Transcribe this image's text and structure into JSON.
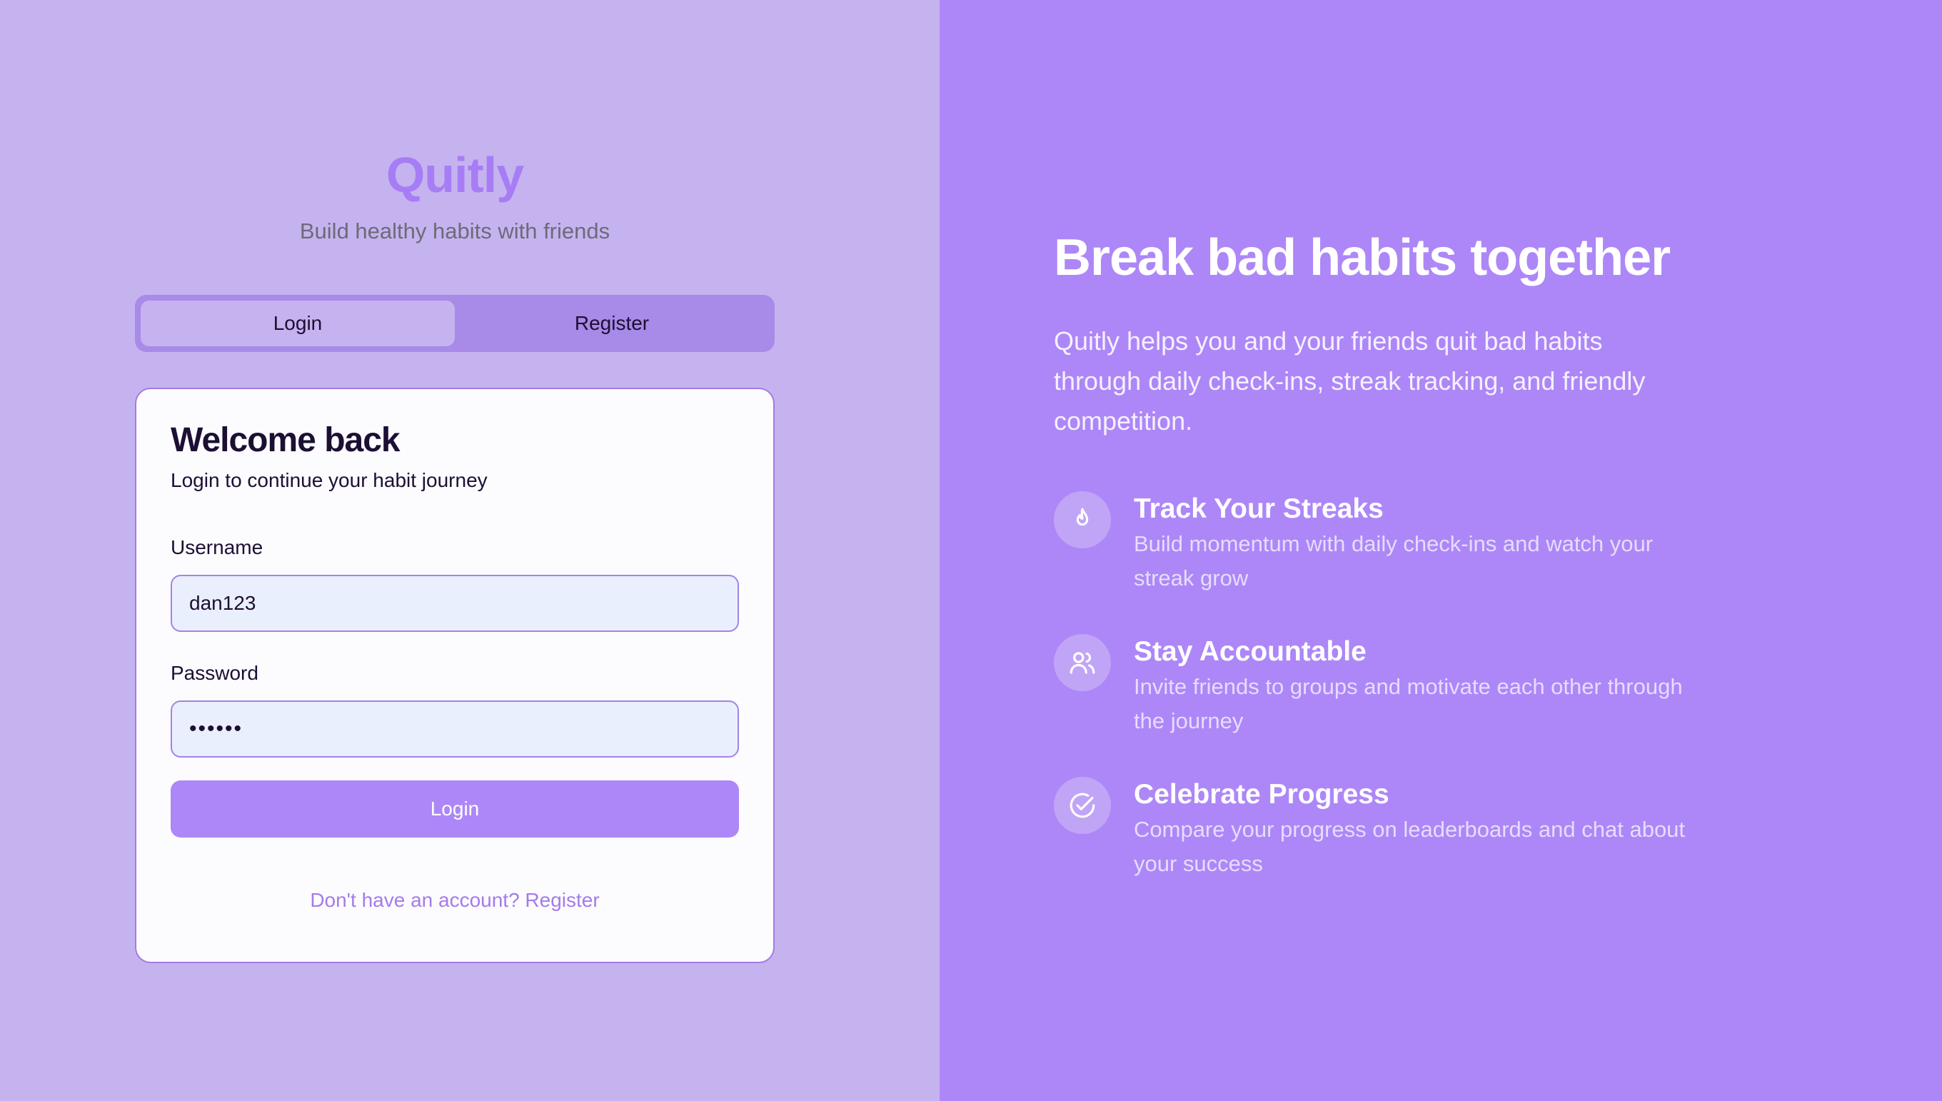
{
  "brand": {
    "name": "Quitly",
    "tagline": "Build healthy habits with friends"
  },
  "tabs": [
    {
      "label": "Login",
      "active": true
    },
    {
      "label": "Register",
      "active": false
    }
  ],
  "login_form": {
    "title": "Welcome back",
    "subtitle": "Login to continue your habit journey",
    "username_label": "Username",
    "username_value": "dan123",
    "password_label": "Password",
    "password_value": "••••••",
    "submit_label": "Login",
    "switch_link": "Don't have an account? Register"
  },
  "hero": {
    "title": "Break bad habits together",
    "description": "Quitly helps you and your friends quit bad habits through daily check-ins, streak tracking, and friendly competition."
  },
  "features": [
    {
      "icon": "flame-icon",
      "title": "Track Your Streaks",
      "description": "Build momentum with daily check-ins and watch your streak grow"
    },
    {
      "icon": "users-icon",
      "title": "Stay Accountable",
      "description": "Invite friends to groups and motivate each other through the journey"
    },
    {
      "icon": "check-circle-icon",
      "title": "Celebrate Progress",
      "description": "Compare your progress on leaderboards and chat about your success"
    }
  ],
  "colors": {
    "left_bg": "#c5b3f0",
    "right_bg": "#ad87f7",
    "accent": "#a77df5",
    "input_bg": "#e9effc"
  }
}
